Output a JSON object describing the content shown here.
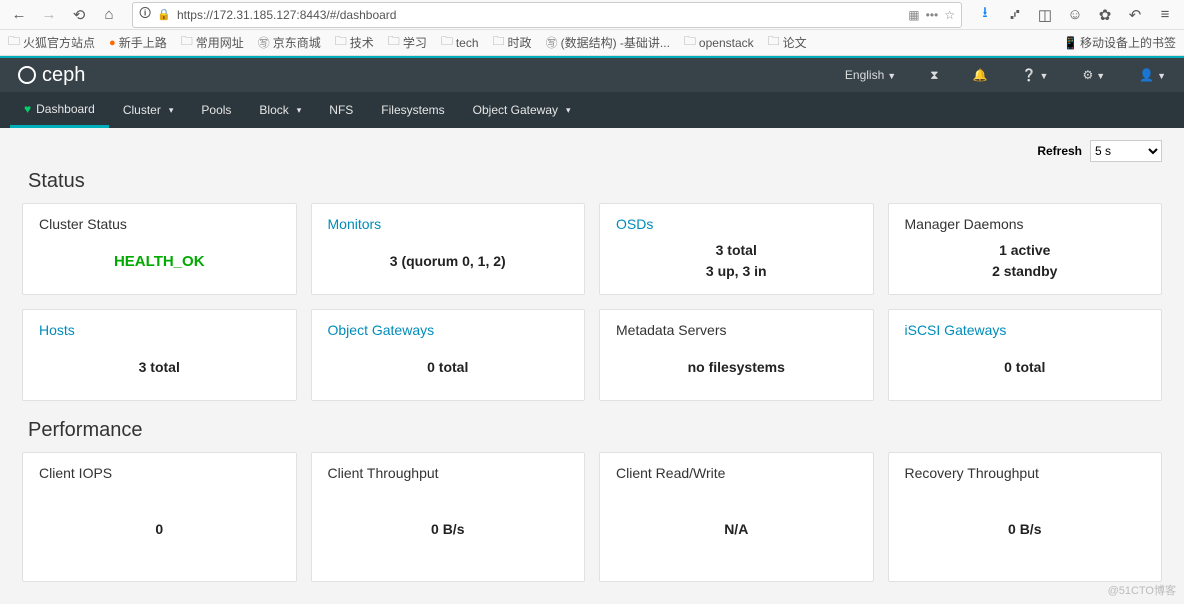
{
  "browser": {
    "url": "https://172.31.185.127:8443/#/dashboard",
    "bookmarks": [
      "火狐官方站点",
      "新手上路",
      "常用网址",
      "京东商城",
      "技术",
      "学习",
      "tech",
      "时政",
      "(数据结构) -基础讲...",
      "openstack",
      "论文"
    ],
    "device_bm": "移动设备上的书签"
  },
  "ceph": {
    "brand": "ceph",
    "lang": "English",
    "nav": [
      "Dashboard",
      "Cluster",
      "Pools",
      "Block",
      "NFS",
      "Filesystems",
      "Object Gateway"
    ],
    "refresh_label": "Refresh",
    "refresh_value": "5 s"
  },
  "status": {
    "heading": "Status",
    "cards": {
      "cluster": {
        "title": "Cluster Status",
        "value": "HEALTH_OK"
      },
      "monitors": {
        "title": "Monitors",
        "value": "3 (quorum 0, 1, 2)"
      },
      "osds": {
        "title": "OSDs",
        "line1": "3 total",
        "line2": "3 up, 3 in"
      },
      "mgr": {
        "title": "Manager Daemons",
        "line1": "1 active",
        "line2": "2 standby"
      },
      "hosts": {
        "title": "Hosts",
        "value": "3 total"
      },
      "ogw": {
        "title": "Object Gateways",
        "value": "0 total"
      },
      "mds": {
        "title": "Metadata Servers",
        "value": "no filesystems"
      },
      "iscsi": {
        "title": "iSCSI Gateways",
        "value": "0 total"
      }
    }
  },
  "perf": {
    "heading": "Performance",
    "cards": {
      "iops": {
        "title": "Client IOPS",
        "value": "0"
      },
      "thru": {
        "title": "Client Throughput",
        "value": "0 B/s"
      },
      "rw": {
        "title": "Client Read/Write",
        "value": "N/A"
      },
      "recov": {
        "title": "Recovery Throughput",
        "value": "0 B/s"
      }
    }
  },
  "watermark": "@51CTO博客"
}
